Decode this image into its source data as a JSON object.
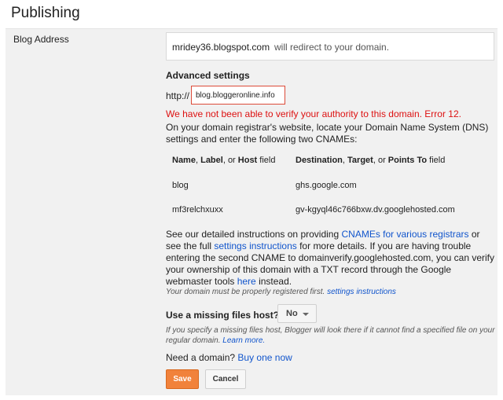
{
  "page": {
    "title": "Publishing"
  },
  "blog_address": {
    "label": "Blog Address",
    "current_domain": "mridey36.blogspot.com",
    "redirect_text": "will redirect to your domain."
  },
  "advanced": {
    "title": "Advanced settings",
    "http_prefix": "http://",
    "domain_value": "blog.bloggeronline.info",
    "error": "We have not been able to verify your authority to this domain. Error 12.",
    "intro": "On your domain registrar's website, locate your Domain Name System (DNS) settings and enter the following two CNAMEs:"
  },
  "cname_table": {
    "header_col1": {
      "name": "Name",
      "sep1": ", ",
      "label": "Label",
      "sep2": ", or ",
      "host": "Host",
      "suffix": " field"
    },
    "header_col2": {
      "destination": "Destination",
      "sep1": ", ",
      "target": "Target",
      "sep2": ", or ",
      "points_to": "Points To",
      "suffix": " field"
    },
    "rows": [
      {
        "name": "blog",
        "destination": "ghs.google.com"
      },
      {
        "name": "mf3relchxuxx",
        "destination": "gv-kgyql46c766bxw.dv.googlehosted.com"
      }
    ]
  },
  "details": {
    "part1": "See our detailed instructions on providing ",
    "link1": "CNAMEs for various registrars",
    "part2": " or see the full ",
    "link2": "settings instructions",
    "part3": " for more details. If you are having trouble entering the second CNAME to domainverify.googlehosted.com, you can verify your ownership of this domain with a TXT record through the Google webmaster tools ",
    "link3": "here",
    "part4": " instead."
  },
  "note": {
    "text": "Your domain must be properly registered first. ",
    "link": "settings instructions"
  },
  "missing_host": {
    "label": "Use a missing files host?",
    "selected": "No",
    "desc": "If you specify a missing files host, Blogger will look there if it cannot find a specified file on your regular domain. ",
    "learn_more": "Learn more."
  },
  "need_domain": {
    "text": "Need a domain? ",
    "link": "Buy one now"
  },
  "actions": {
    "save": "Save",
    "cancel": "Cancel"
  },
  "colors": {
    "error": "#dd1111",
    "link": "#1155cc",
    "save_button": "#f1823b",
    "input_error_border": "#dd4b39"
  }
}
